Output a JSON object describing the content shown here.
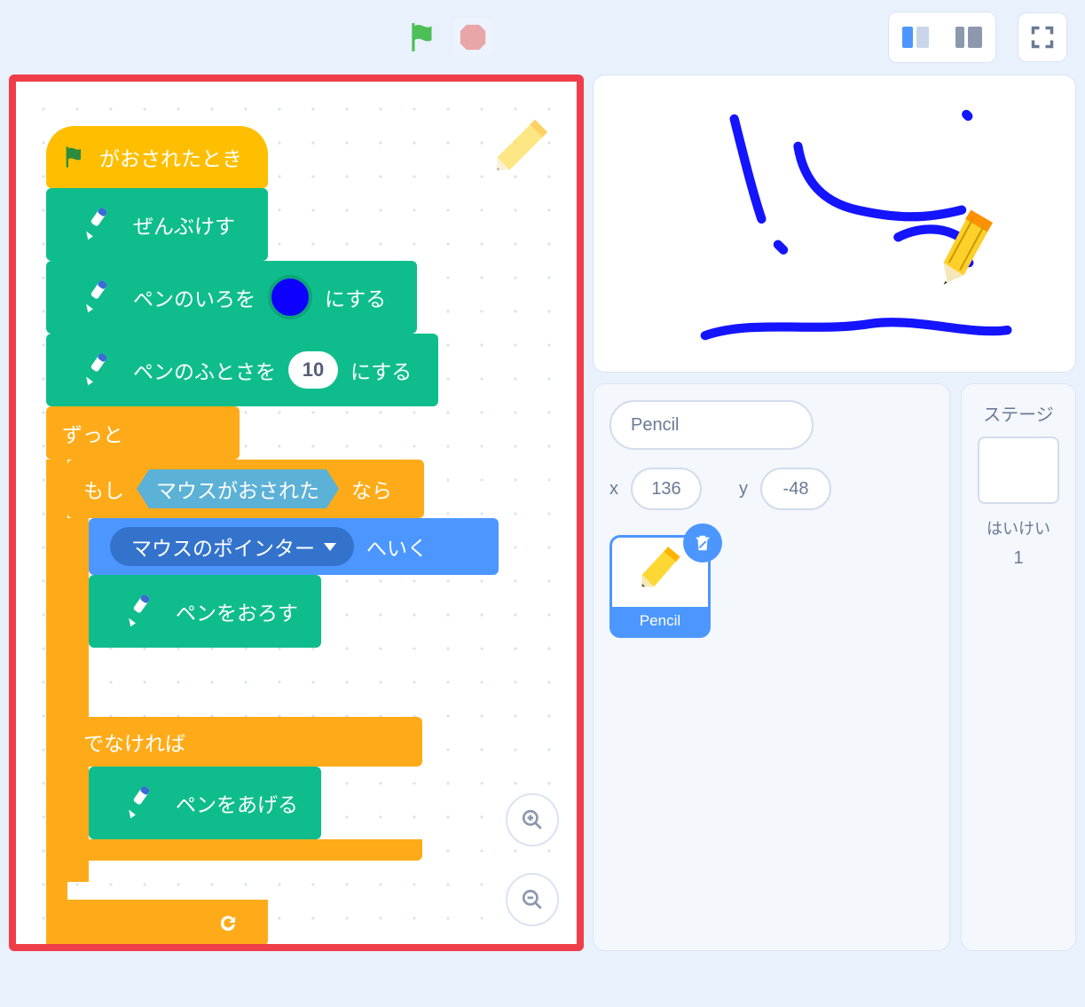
{
  "blocks": {
    "when_flag_clicked": "がおされたとき",
    "erase_all": "ぜんぶけす",
    "set_pen_color_prefix": "ペンのいろを",
    "set_suffix": "にする",
    "set_pen_size_prefix": "ペンのふとさを",
    "pen_size_value": "10",
    "pen_color_value": "#0d00ff",
    "forever": "ずっと",
    "if": "もし",
    "mouse_down": "マウスがおされた",
    "then": "なら",
    "goto_prefix": "",
    "mouse_pointer": "マウスのポインター",
    "goto_suffix": "へいく",
    "pen_down": "ペンをおろす",
    "else": "でなければ",
    "pen_up": "ペンをあげる"
  },
  "sprite": {
    "name": "Pencil",
    "x": "136",
    "y": "-48",
    "x_label": "x",
    "y_label": "y",
    "tile_label": "Pencil"
  },
  "stage": {
    "title": "ステージ",
    "backdrops_label": "はいけい",
    "backdrops_count": "1"
  },
  "icons": {
    "flag": "green-flag-icon",
    "stop": "stop-icon",
    "view_small": "small-stage-icon",
    "view_large": "large-stage-icon",
    "fullscreen": "fullscreen-icon",
    "zoom_in": "zoom-in-icon",
    "zoom_out": "zoom-out-icon",
    "delete": "trash-icon",
    "loop_arrow": "loop-arrow-icon"
  }
}
